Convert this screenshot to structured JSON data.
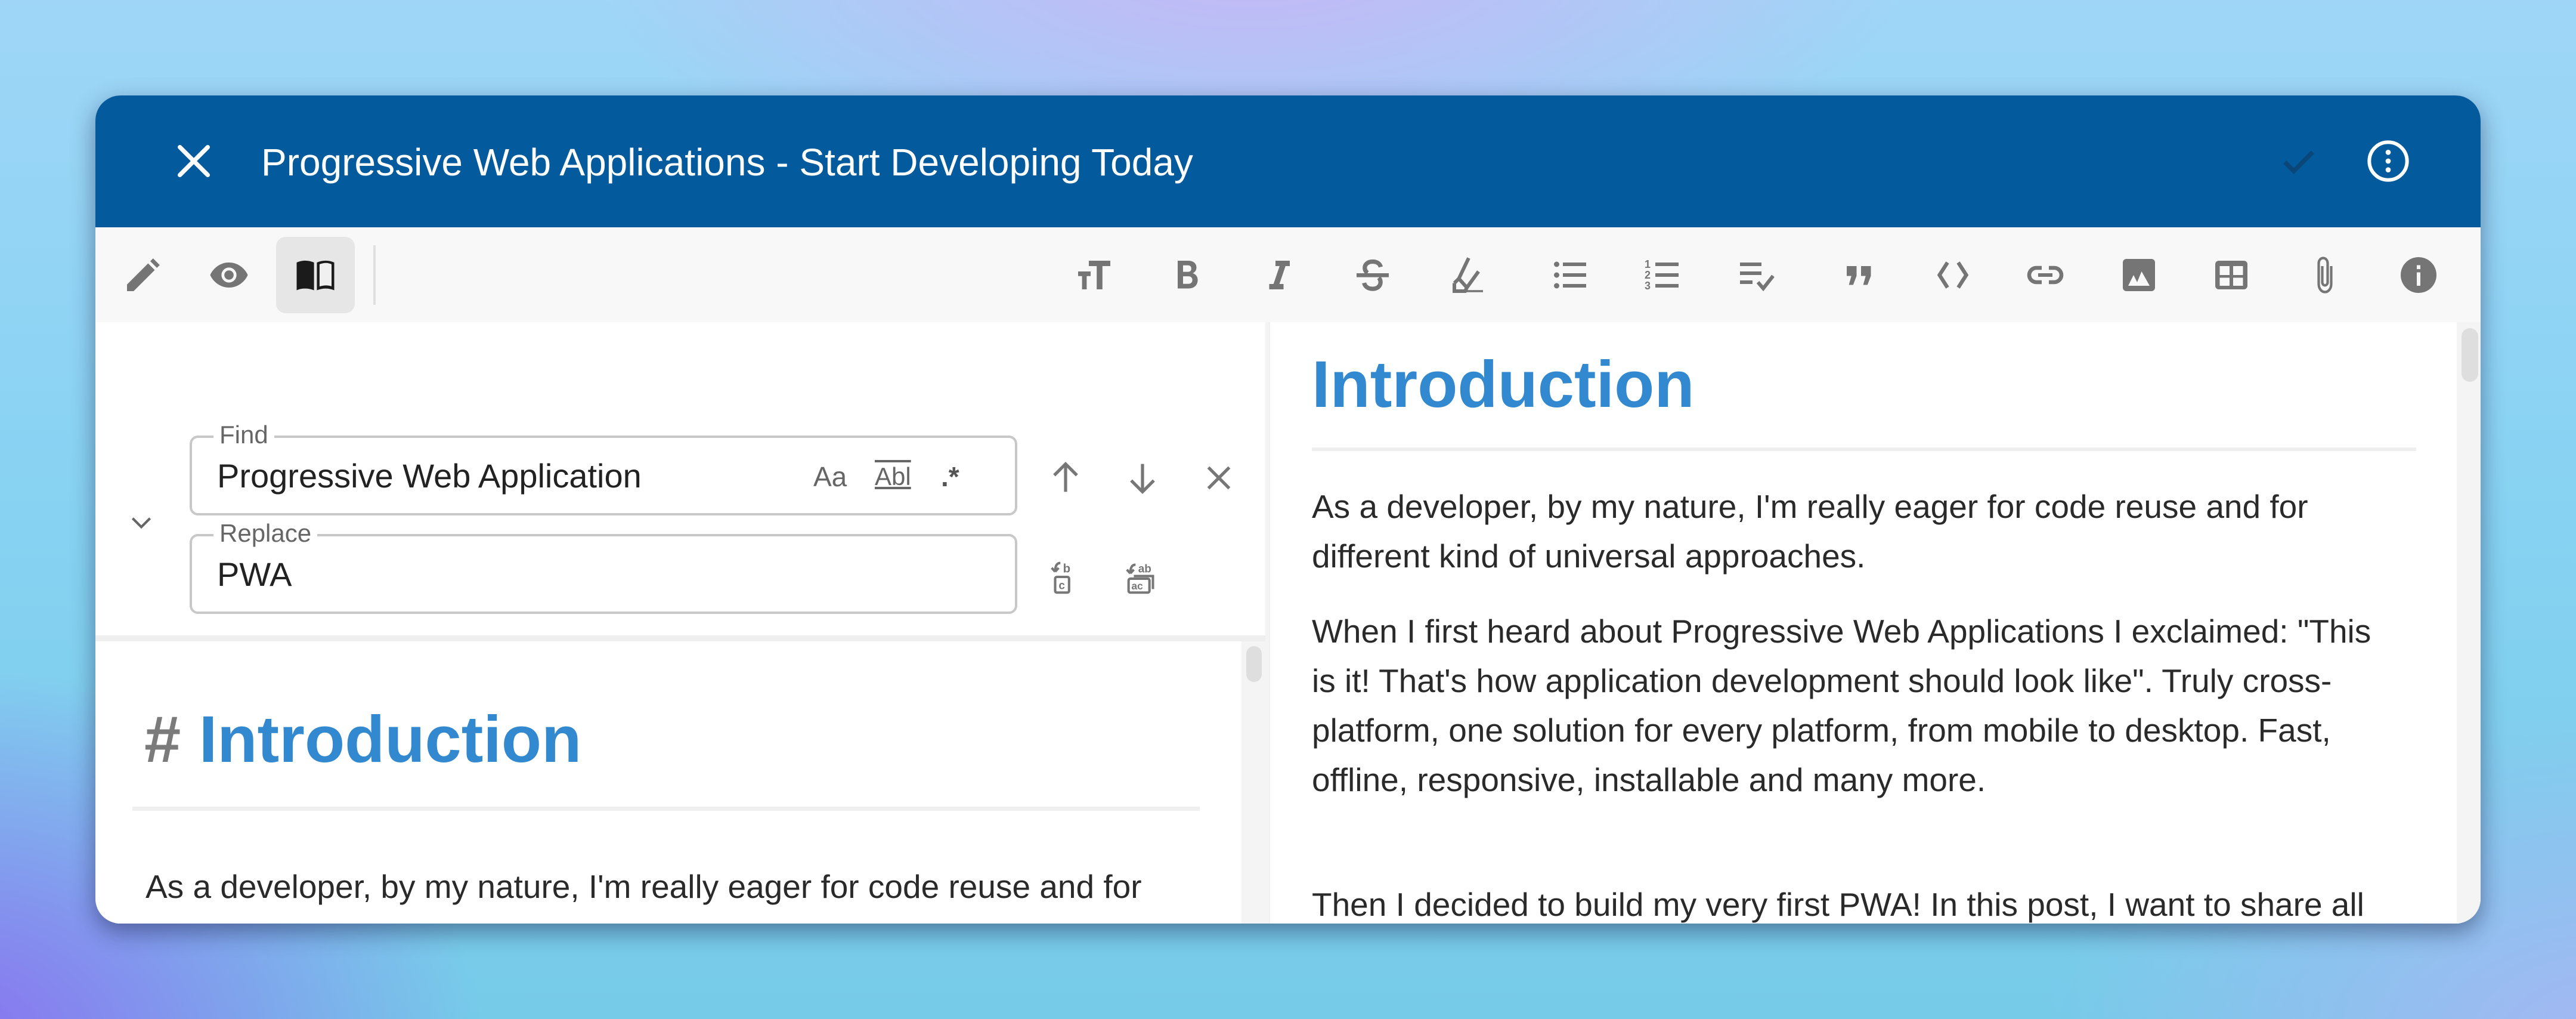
{
  "header": {
    "title": "Progressive Web Applications - Start Developing Today",
    "close_icon": "close-icon",
    "save_icon": "check-icon",
    "more_icon": "more-vertical-circle-icon",
    "background_color": "#035A9C"
  },
  "toolbar": {
    "mode_buttons": [
      {
        "name": "edit",
        "icon": "pencil-icon",
        "active": false
      },
      {
        "name": "preview",
        "icon": "eye-icon",
        "active": false
      },
      {
        "name": "split",
        "icon": "book-open-icon",
        "active": true
      }
    ],
    "format_buttons": [
      {
        "name": "heading",
        "icon": "text-size-icon"
      },
      {
        "name": "bold",
        "icon": "bold-icon"
      },
      {
        "name": "italic",
        "icon": "italic-icon"
      },
      {
        "name": "strikethrough",
        "icon": "strikethrough-icon"
      },
      {
        "name": "highlight",
        "icon": "marker-icon"
      },
      {
        "name": "bulleted-list",
        "icon": "bulleted-list-icon"
      },
      {
        "name": "numbered-list",
        "icon": "numbered-list-icon"
      },
      {
        "name": "checklist",
        "icon": "checklist-icon"
      },
      {
        "name": "quote",
        "icon": "quote-icon"
      },
      {
        "name": "code",
        "icon": "code-icon"
      },
      {
        "name": "link",
        "icon": "link-icon"
      },
      {
        "name": "image",
        "icon": "image-icon"
      },
      {
        "name": "table",
        "icon": "table-icon"
      },
      {
        "name": "attachment",
        "icon": "paperclip-icon"
      },
      {
        "name": "info",
        "icon": "info-icon"
      }
    ]
  },
  "find_replace": {
    "find_label": "Find",
    "find_value": "Progressive Web Application",
    "replace_label": "Replace",
    "replace_value": "PWA",
    "match_case": "Aa",
    "whole_word": "Abl",
    "regex": ".*"
  },
  "editor": {
    "heading_marker": "#",
    "heading": "Introduction",
    "paragraph1": "As a developer, by my nature, I'm really eager for code reuse and for different kind of universal approaches."
  },
  "preview": {
    "heading": "Introduction",
    "paragraphs": [
      "As a developer, by my nature, I'm really eager for code reuse and for different kind of universal approaches.",
      "When I first heard about Progressive Web Applications I exclaimed: \"This is it! That's how application development should look like\". Truly cross-platform, one solution for every platform, from mobile to desktop. Fast, offline, responsive, installable and many more.",
      "Then I decided to build my very first PWA! In this post, I want to share all"
    ]
  },
  "colors": {
    "accent": "#3289CF",
    "header": "#035A9C",
    "icon": "#6f6f6f",
    "match_highlight": "#fefcbf"
  }
}
